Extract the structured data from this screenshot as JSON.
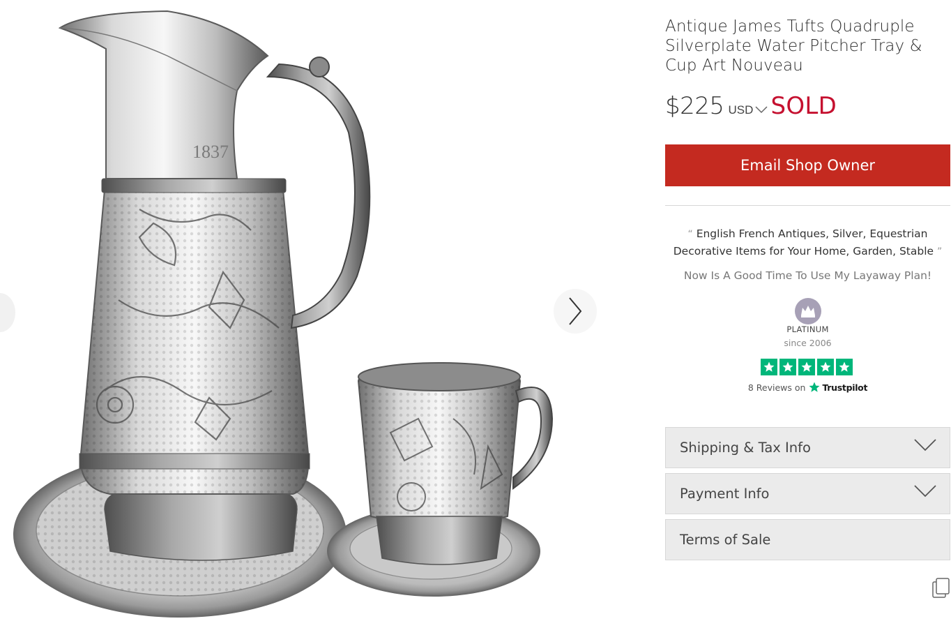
{
  "listing": {
    "title": "Antique James Tufts Quadruple Silverplate Water Pitcher Tray & Cup Art Nouveau",
    "price": "$225",
    "currency": "USD",
    "status": "SOLD"
  },
  "actions": {
    "email_label": "Email Shop Owner"
  },
  "shop": {
    "quote_open": "“",
    "tagline": "English French Antiques, Silver, Equestrian Decorative Items for Your Home, Garden, Stable",
    "quote_close": "”",
    "layaway": "Now Is A Good Time To Use My Layaway Plan!",
    "tier": "PLATINUM",
    "since": "since 2006"
  },
  "trustpilot": {
    "rating_stars": 5,
    "reviews_text": "8 Reviews on",
    "brand": "Trustpilot",
    "star_color": "#00b67a"
  },
  "image": {
    "engraving": "1837"
  },
  "accordion": [
    {
      "label": "Shipping & Tax Info",
      "expandable": true
    },
    {
      "label": "Payment Info",
      "expandable": true
    },
    {
      "label": "Terms of Sale",
      "expandable": false
    }
  ],
  "icons": {
    "next": "chevron-right-icon",
    "prev": "chevron-left-icon",
    "currency_toggle": "chevron-down-icon",
    "badge": "crown-icon",
    "share": "share-icon"
  },
  "colors": {
    "sold": "#c5102f",
    "button": "#c42a20",
    "accordion_bg": "#ebebeb"
  }
}
